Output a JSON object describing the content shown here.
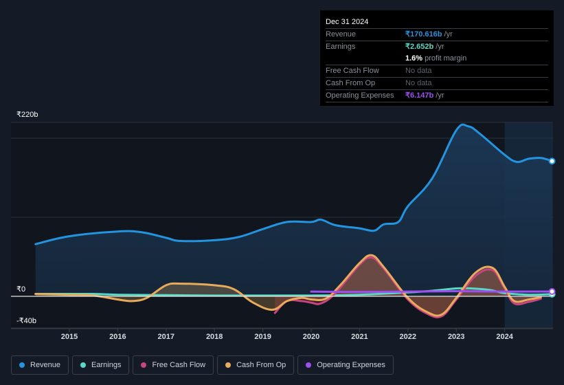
{
  "tooltip": {
    "date": "Dec 31 2024",
    "rows": [
      {
        "label": "Revenue",
        "value": "₹170.616b",
        "suffix": " /yr"
      },
      {
        "label": "Earnings",
        "value": "₹2.652b",
        "suffix": " /yr"
      },
      {
        "label": "",
        "value": "1.6%",
        "suffix": " profit margin"
      },
      {
        "label": "Free Cash Flow",
        "value": "No data",
        "suffix": ""
      },
      {
        "label": "Cash From Op",
        "value": "No data",
        "suffix": ""
      },
      {
        "label": "Operating Expenses",
        "value": "₹6.147b",
        "suffix": " /yr"
      }
    ]
  },
  "legend": [
    {
      "label": "Revenue",
      "color": "#2394df"
    },
    {
      "label": "Earnings",
      "color": "#5ad8c6"
    },
    {
      "label": "Free Cash Flow",
      "color": "#c9457f"
    },
    {
      "label": "Cash From Op",
      "color": "#e8ab5c"
    },
    {
      "label": "Operating Expenses",
      "color": "#9d4ff0"
    }
  ],
  "chart_data": {
    "type": "area",
    "title": "",
    "xlabel": "",
    "ylabel": "",
    "ylim": [
      -40,
      220
    ],
    "xlim": [
      2014.3,
      2025.0
    ],
    "y_tick_labels": [
      {
        "value": 220,
        "label": "₹220b"
      },
      {
        "value": 0,
        "label": "₹0"
      },
      {
        "value": -40,
        "label": "-₹40b"
      }
    ],
    "y_gridlines": [
      220,
      200,
      100,
      0,
      -40
    ],
    "x_ticks": [
      2015,
      2016,
      2017,
      2018,
      2019,
      2020,
      2021,
      2022,
      2023,
      2024
    ],
    "x_tick_labels": [
      "2015",
      "2016",
      "2017",
      "2018",
      "2019",
      "2020",
      "2021",
      "2022",
      "2023",
      "2024"
    ],
    "highlight_from": 2024.0,
    "grid": true,
    "legend_position": "bottom",
    "series": [
      {
        "name": "Revenue",
        "color": "#2394df",
        "fill": true,
        "x": [
          2014.3,
          2015.0,
          2016.0,
          2016.5,
          2017.0,
          2017.3,
          2018.0,
          2018.5,
          2019.0,
          2019.5,
          2020.0,
          2020.2,
          2020.5,
          2021.0,
          2021.3,
          2021.5,
          2021.8,
          2022.0,
          2022.5,
          2023.0,
          2023.25,
          2023.5,
          2024.0,
          2024.25,
          2024.5,
          2024.75,
          2024.98
        ],
        "y": [
          66,
          76,
          82,
          81,
          74,
          70,
          71,
          75,
          85,
          94,
          94,
          97,
          90,
          86,
          83,
          91,
          94,
          114,
          149,
          210,
          215,
          205,
          179,
          170,
          174,
          175,
          171
        ]
      },
      {
        "name": "Earnings",
        "color": "#5ad8c6",
        "fill": false,
        "x": [
          2014.3,
          2015.0,
          2015.5,
          2016.0,
          2017.0,
          2018.0,
          2019.0,
          2020.0,
          2021.0,
          2022.0,
          2022.5,
          2023.0,
          2023.3,
          2023.7,
          2024.0,
          2024.5,
          2024.98
        ],
        "y": [
          3,
          3,
          3,
          2,
          1.5,
          1,
          1,
          1,
          2,
          5,
          7,
          10,
          10,
          8,
          4,
          2,
          2.7
        ]
      },
      {
        "name": "Free Cash Flow",
        "color": "#c9457f",
        "fill": true,
        "x": [
          2019.25,
          2019.5,
          2019.8,
          2020.0,
          2020.2,
          2020.5,
          2021.0,
          2021.25,
          2021.5,
          2022.0,
          2022.4,
          2022.7,
          2023.0,
          2023.4,
          2023.75,
          2024.0,
          2024.2,
          2024.5,
          2024.75
        ],
        "y": [
          -21,
          -6,
          -6,
          -8,
          -9,
          4,
          40,
          49,
          35,
          -4,
          -22,
          -25,
          -4,
          26,
          33,
          10,
          -9,
          -7,
          -3
        ]
      },
      {
        "name": "Cash From Op",
        "color": "#e8ab5c",
        "fill": true,
        "x": [
          2014.3,
          2015.0,
          2015.5,
          2016.0,
          2016.3,
          2016.6,
          2017.0,
          2017.3,
          2018.0,
          2018.4,
          2018.8,
          2019.2,
          2019.5,
          2019.8,
          2020.0,
          2020.3,
          2020.6,
          2021.0,
          2021.25,
          2021.5,
          2022.0,
          2022.4,
          2022.7,
          2023.0,
          2023.4,
          2023.75,
          2024.0,
          2024.2,
          2024.5,
          2024.75
        ],
        "y": [
          3,
          2,
          1,
          -4,
          -6,
          -2,
          14,
          16,
          14,
          9,
          -8,
          -17,
          -6,
          -2,
          -4,
          -3,
          14,
          42,
          52,
          37,
          -2,
          -20,
          -23,
          -2,
          30,
          36,
          12,
          -6,
          -4,
          -1
        ]
      },
      {
        "name": "Operating Expenses",
        "color": "#9d4ff0",
        "fill": false,
        "x": [
          2020.0,
          2021.0,
          2022.0,
          2023.0,
          2024.0,
          2024.5,
          2024.98
        ],
        "y": [
          6,
          5.5,
          6,
          6.5,
          6,
          6,
          6.1
        ]
      }
    ]
  }
}
